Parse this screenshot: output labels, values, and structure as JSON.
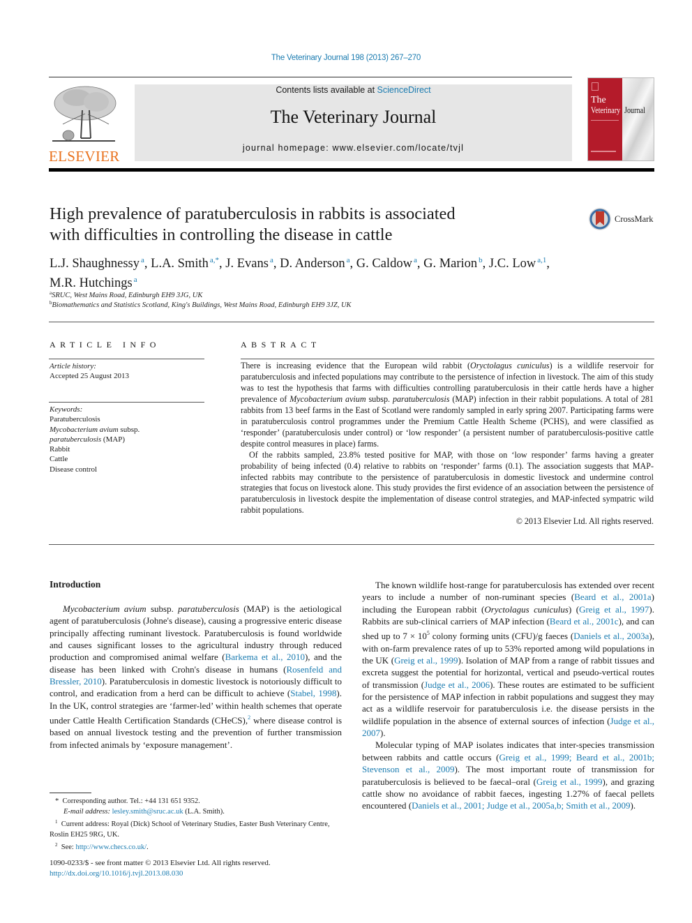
{
  "running_head": "The Veterinary Journal 198 (2013) 267–270",
  "banner": {
    "contents_prefix": "Contents lists available at ",
    "contents_link": "ScienceDirect",
    "journal_name": "The Veterinary Journal",
    "homepage_prefix": "journal homepage: ",
    "homepage_url": "www.elsevier.com/locate/tvjl"
  },
  "publisher_logo": {
    "wordmark": "ELSEVIER",
    "color": "#e9711c"
  },
  "cover": {
    "line1": "The",
    "line2": "Veterinary",
    "line3": "Journal",
    "color": "#b41b2a"
  },
  "crossmark_label": "CrossMark",
  "article": {
    "title_line1": "High prevalence of paratuberculosis in rabbits is associated",
    "title_line2": "with difficulties in controlling the disease in cattle",
    "authors": [
      {
        "name": "L.J. Shaughnessy",
        "sup": "a"
      },
      {
        "name": "L.A. Smith",
        "sup": "a,*"
      },
      {
        "name": "J. Evans",
        "sup": "a"
      },
      {
        "name": "D. Anderson",
        "sup": "a"
      },
      {
        "name": "G. Caldow",
        "sup": "a"
      },
      {
        "name": "G. Marion",
        "sup": "b"
      },
      {
        "name": "J.C. Low",
        "sup": "a,1"
      },
      {
        "name": "M.R. Hutchings",
        "sup": "a"
      }
    ],
    "affiliations": [
      {
        "sup": "a",
        "text": "SRUC, West Mains Road, Edinburgh EH9 3JG, UK"
      },
      {
        "sup": "b",
        "text": "Biomathematics and Statistics Scotland, King's Buildings, West Mains Road, Edinburgh EH9 3JZ, UK"
      }
    ]
  },
  "article_info": {
    "heading": "ARTICLE INFO",
    "history_label": "Article history:",
    "history_value": "Accepted 25 August 2013",
    "keywords_label": "Keywords:",
    "keywords": [
      "Paratuberculosis",
      "Mycobacterium avium subsp.",
      "paratuberculosis (MAP)",
      "Rabbit",
      "Cattle",
      "Disease control"
    ]
  },
  "abstract": {
    "heading": "ABSTRACT",
    "p1_a": "There is increasing evidence that the European wild rabbit (",
    "p1_i1": "Oryctolagus cuniculus",
    "p1_b": ") is a wildlife reservoir for paratuberculosis and infected populations may contribute to the persistence of infection in livestock. The aim of this study was to test the hypothesis that farms with difficulties controlling paratuberculosis in their cattle herds have a higher prevalence of ",
    "p1_i2": "Mycobacterium avium",
    "p1_c": " subsp. ",
    "p1_i3": "paratuberculosis",
    "p1_d": " (MAP) infection in their rabbit populations. A total of 281 rabbits from 13 beef farms in the East of Scotland were randomly sampled in early spring 2007. Participating farms were in paratuberculosis control programmes under the Premium Cattle Health Scheme (PCHS), and were classified as ‘responder’ (paratuberculosis under control) or ‘low responder’ (a persistent number of paratuberculosis-positive cattle despite control measures in place) farms.",
    "p2": "Of the rabbits sampled, 23.8% tested positive for MAP, with those on ‘low responder’ farms having a greater probability of being infected (0.4) relative to rabbits on ‘responder’ farms (0.1). The association suggests that MAP-infected rabbits may contribute to the persistence of paratuberculosis in domestic livestock and undermine control strategies that focus on livestock alone. This study provides the first evidence of an association between the persistence of paratuberculosis in livestock despite the implementation of disease control strategies, and MAP-infected sympatric wild rabbit populations.",
    "copyright": "© 2013 Elsevier Ltd. All rights reserved."
  },
  "introduction": {
    "heading": "Introduction",
    "left": {
      "i1": "Mycobacterium avium",
      "t1": " subsp. ",
      "i2": "paratuberculosis",
      "t2": " (MAP) is the aetiological agent of paratuberculosis (Johne's disease), causing a progressive enteric disease principally affecting ruminant livestock. Paratuberculosis is found worldwide and causes significant losses to the agricultural industry through reduced production and compromised animal welfare (",
      "r1": "Barkema et al., 2010",
      "t3": "), and the disease has been linked with Crohn's disease in humans (",
      "r2": "Rosenfeld and Bressler, 2010",
      "t4": "). Paratuberculosis in domestic livestock is notoriously difficult to control, and eradication from a herd can be difficult to achieve (",
      "r3": "Stabel, 1998",
      "t5": "). In the UK, control strategies are ‘farmer-led’ within health schemes that operate under Cattle Health Certification Standards (CHeCS),",
      "fn2": "2",
      "t6": " where disease control is based on annual livestock testing and the prevention of further transmission from infected animals by ‘exposure management’."
    },
    "right_p1": {
      "t1": "The known wildlife host-range for paratuberculosis has extended over recent years to include a number of non-ruminant species (",
      "r1": "Beard et al., 2001a",
      "t2": ") including the European rabbit (",
      "i1": "Oryctolagus cuniculus",
      "t3": ") (",
      "r2": "Greig et al., 1997",
      "t4": "). Rabbits are sub-clinical carriers of MAP infection (",
      "r3": "Beard et al., 2001c",
      "t5": "), and can shed up to 7 × 10",
      "exp": "5",
      "t6": " colony forming units (CFU)/g faeces (",
      "r4": "Daniels et al., 2003a",
      "t7": "), with on-farm prevalence rates of up to 53% reported among wild populations in the UK (",
      "r5": "Greig et al., 1999",
      "t8": "). Isolation of MAP from a range of rabbit tissues and excreta suggest the potential for horizontal, vertical and pseudo-vertical routes of transmission (",
      "r6": "Judge et al., 2006",
      "t9": "). These routes are estimated to be sufficient for the persistence of MAP infection in rabbit populations and suggest they may act as a wildlife reservoir for paratuberculosis i.e. the disease persists in the wildlife population in the absence of external sources of infection (",
      "r7": "Judge et al., 2007",
      "t10": ")."
    },
    "right_p2": {
      "t1": "Molecular typing of MAP isolates indicates that inter-species transmission between rabbits and cattle occurs (",
      "r1": "Greig et al., 1999; Beard et al., 2001b; Stevenson et al., 2009",
      "t2": "). The most important route of transmission for paratuberculosis is believed to be faecal–oral (",
      "r2": "Greig et al., 1999",
      "t3": "), and grazing cattle show no avoidance of rabbit faeces, ingesting 1.27% of faecal pellets encountered (",
      "r3": "Daniels et al., 2001; Judge et al., 2005a,b; Smith et al., 2009",
      "t4": ")."
    }
  },
  "footnotes": {
    "corr_mark": "*",
    "corr_text": "Corresponding author. Tel.: +44 131 651 9352.",
    "email_label": "E-mail address:",
    "email": "lesley.smith@sruc.ac.uk",
    "email_owner": "(L.A. Smith).",
    "fn1_mark": "1",
    "fn1_text": "Current address: Royal (Dick) School of Veterinary Studies, Easter Bush Veterinary Centre, Roslin EH25 9RG, UK.",
    "fn2_mark": "2",
    "fn2_label": "See: ",
    "fn2_url": "http://www.checs.co.uk/",
    "fn2_end": "."
  },
  "front_matter": {
    "issn_line": "1090-0233/$ - see front matter © 2013 Elsevier Ltd. All rights reserved.",
    "doi": "http://dx.doi.org/10.1016/j.tvjl.2013.08.030"
  }
}
